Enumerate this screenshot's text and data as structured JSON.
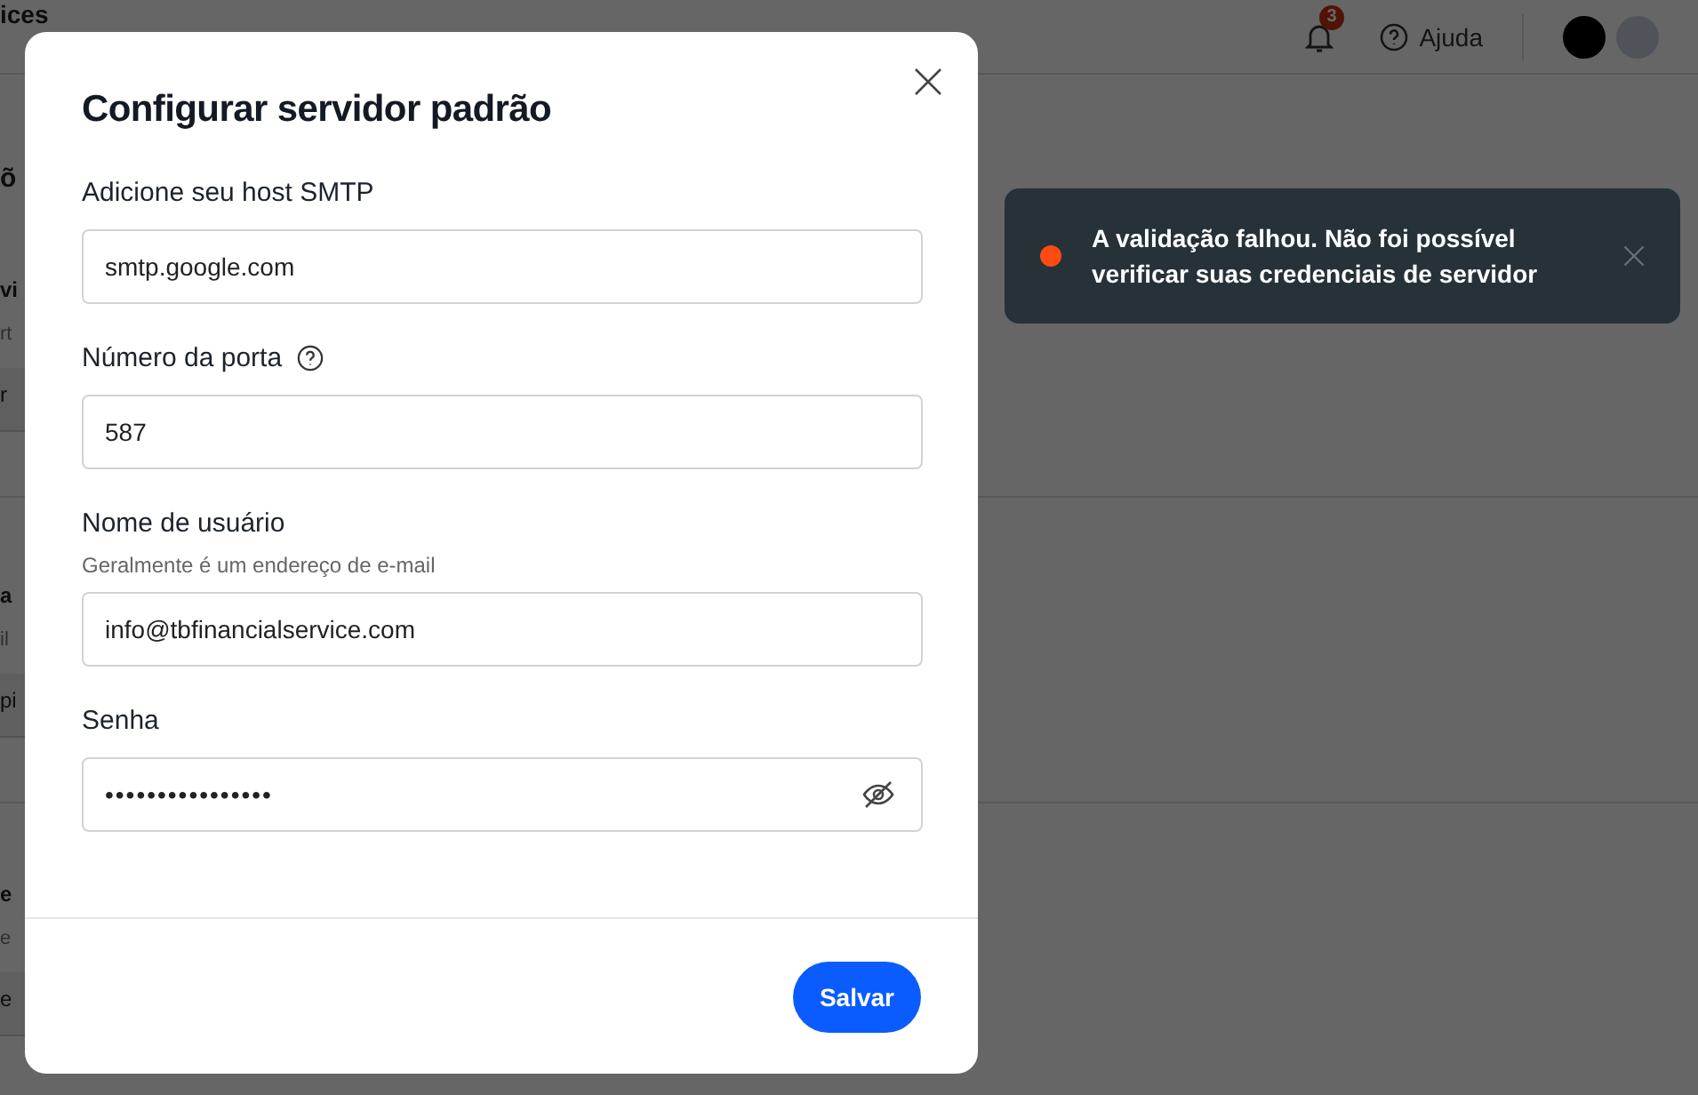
{
  "header": {
    "title": "ices",
    "notifications": {
      "count": "3"
    },
    "help": {
      "label": "Ajuda"
    }
  },
  "background_fragments": [
    {
      "kind": "heading",
      "text": "õ"
    },
    {
      "kind": "title",
      "text": "vi"
    },
    {
      "kind": "sub",
      "text": "rt"
    },
    {
      "kind": "field",
      "text": "r"
    },
    {
      "kind": "divider"
    },
    {
      "kind": "title",
      "text": "a"
    },
    {
      "kind": "sub",
      "text": "il"
    },
    {
      "kind": "field",
      "text": "pi"
    },
    {
      "kind": "divider"
    },
    {
      "kind": "title",
      "text": "e"
    },
    {
      "kind": "sub",
      "text": "e"
    },
    {
      "kind": "field",
      "text": "e"
    }
  ],
  "modal": {
    "title": "Configurar servidor padrão",
    "fields": [
      {
        "label": "Adicione seu host SMTP",
        "value": "smtp.google.com",
        "help_icon": false,
        "masked": false
      },
      {
        "label": "Número da porta",
        "value": "587",
        "help_icon": true,
        "masked": false
      },
      {
        "label": "Nome de usuário",
        "value": "info@tbfinancialservice.com",
        "help_icon": false,
        "hint": "Geralmente é um endereço de e-mail",
        "masked": false
      },
      {
        "label": "Senha",
        "value": "••••••••••••••••",
        "help_icon": false,
        "masked": true
      }
    ],
    "save_button": "Salvar"
  },
  "toast": {
    "message": "A validação falhou. Não foi possível verificar suas credenciais de servidor",
    "color": "#ff4a12"
  }
}
